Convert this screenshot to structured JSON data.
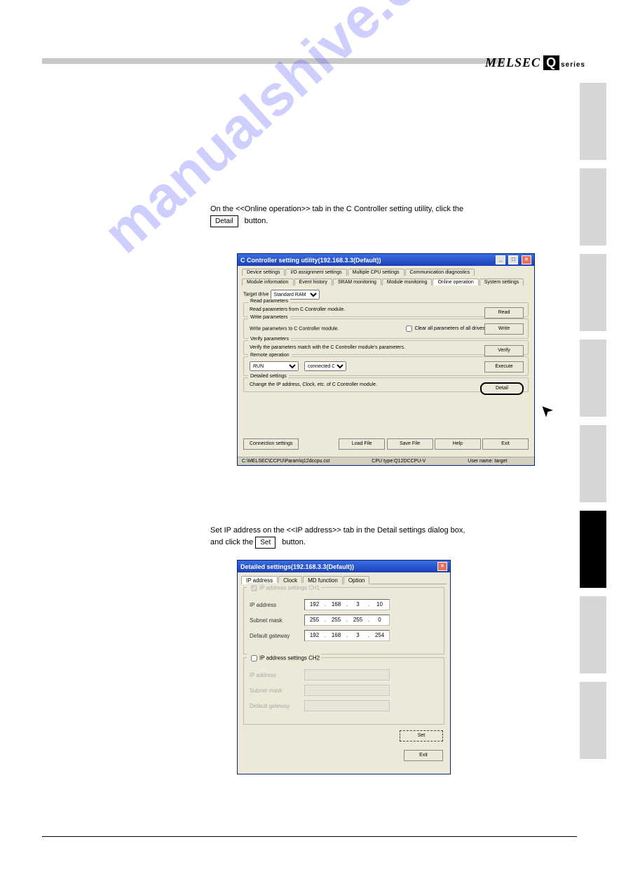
{
  "header": {
    "brand_prefix": "MELSEC",
    "brand_box": "Q",
    "brand_suffix": "series"
  },
  "watermark": "manualshive.com",
  "step_top": {
    "title": "On the <<Online operation>> tab in the C Controller setting utility, click the",
    "button_ref": "Detail",
    "tail": "button."
  },
  "step_mid": {
    "title": "Set IP address on the <<IP address>> tab in the Detail settings dialog box,",
    "line2": "and click the",
    "button_ref": "Set",
    "tail": "button."
  },
  "window1": {
    "title": "C Controller setting utility(192.168.3.3(Default))",
    "tabs_row1": [
      "Device settings",
      "I/O assignment settings",
      "Multiple CPU settings",
      "Communication diagnostics"
    ],
    "tabs_row2": [
      "Module information",
      "Event history",
      "SRAM monitoring",
      "Module monitoring",
      "Online operation",
      "System settings"
    ],
    "target_drive_label": "Target drive",
    "target_drive_value": "Standard RAM",
    "groups": {
      "read": {
        "legend": "Read parameters",
        "desc": "Read parameters from C Controller module.",
        "btn": "Read"
      },
      "write": {
        "legend": "Write parameters",
        "desc": "Write parameters to C Controller module.",
        "chk": "Clear all parameters of all drives prior to writing.",
        "btn": "Write"
      },
      "verify": {
        "legend": "Verify parameters",
        "desc": "Verify the parameters match with the C Controller module's parameters.",
        "btn": "Verify"
      },
      "remote": {
        "legend": "Remote operation",
        "sel1": "RUN",
        "sel2": "connected CPU",
        "btn": "Execute"
      },
      "detail": {
        "legend": "Detailed settings",
        "desc": "Change the IP address, Clock, etc. of C Controller module.",
        "btn": "Detail"
      }
    },
    "bottom": {
      "conn": "Connection settings",
      "load": "Load File",
      "save": "Save File",
      "help": "Help",
      "exit": "Exit"
    },
    "status": {
      "path": "C:\\MELSEC\\CCPU\\Param\\q12dccpu.cst",
      "cpu": "CPU type:Q12DCCPU-V",
      "user": "User name: target"
    }
  },
  "window2": {
    "title": "Detailed settings(192.168.3.3(Default))",
    "tabs": [
      "IP address",
      "Clock",
      "MD function",
      "Option"
    ],
    "ch1": {
      "legend": "IP address settings CH1",
      "ip_label": "IP address",
      "ip": [
        "192",
        "168",
        "3",
        "10"
      ],
      "mask_label": "Subnet mask",
      "mask": [
        "255",
        "255",
        "255",
        "0"
      ],
      "gw_label": "Default gateway",
      "gw": [
        "192",
        "168",
        "3",
        "254"
      ]
    },
    "ch2": {
      "legend": "IP address settings CH2",
      "ip_label": "IP address",
      "mask_label": "Subnet mask",
      "gw_label": "Default gateway"
    },
    "set_btn": "Set",
    "exit_btn": "Exit"
  }
}
